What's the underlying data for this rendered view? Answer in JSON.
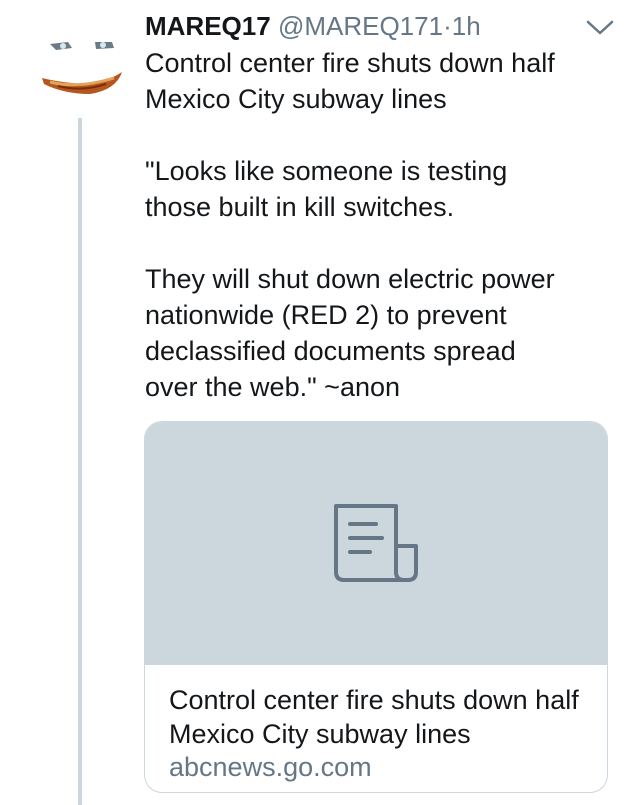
{
  "tweet": {
    "display_name": "MAREQ17",
    "handle": "@MAREQ171",
    "separator": "·",
    "time": "1h",
    "text": "Control center fire shuts down half\nMexico City subway lines\n\n\"Looks like someone is testing\nthose built in kill switches.\n\nThey will shut down electric power\nnationwide (RED 2) to prevent\ndeclassified documents spread\nover the web.\" ~anon",
    "avatar_icon": "avatar-image",
    "menu_icon": "chevron-down-icon"
  },
  "card": {
    "title": "Control center fire shuts down half Mexico City subway lines",
    "domain": "abcnews.go.com",
    "placeholder_icon": "document-icon"
  },
  "colors": {
    "text": "#14171a",
    "secondary_text": "#657786",
    "thread_line": "#ccd6dd",
    "card_media_bg": "#ccd6dd",
    "icon_stroke": "#657786"
  }
}
